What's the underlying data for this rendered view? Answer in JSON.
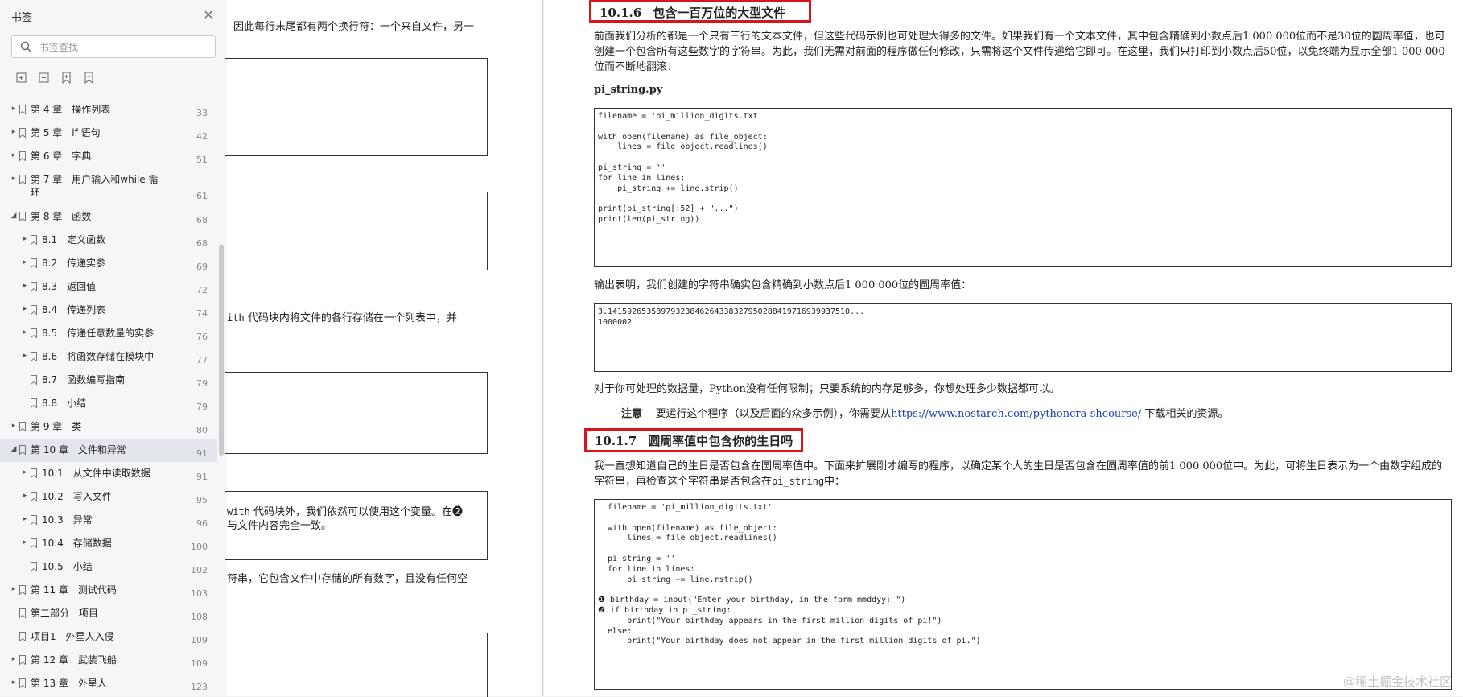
{
  "sidebar": {
    "title": "书签",
    "search_placeholder": "书签查找",
    "bookmarks": [
      {
        "label": "第 4 章　操作列表",
        "page": "33",
        "level": 0,
        "arrow": "right"
      },
      {
        "label": "第 5 章　if 语句",
        "page": "42",
        "level": 0,
        "arrow": "right"
      },
      {
        "label": "第 6 章　字典",
        "page": "51",
        "level": 0,
        "arrow": "right"
      },
      {
        "label": "第 7 章　用户输入和while 循",
        "label2": "环",
        "page": "61",
        "level": 0,
        "arrow": "right"
      },
      {
        "label": "第 8 章　函数",
        "page": "68",
        "level": 0,
        "arrow": "down"
      },
      {
        "label": "8.1　定义函数",
        "page": "68",
        "level": 1,
        "arrow": "right"
      },
      {
        "label": "8.2　传递实参",
        "page": "69",
        "level": 1,
        "arrow": "right"
      },
      {
        "label": "8.3　返回值",
        "page": "72",
        "level": 1,
        "arrow": "right"
      },
      {
        "label": "8.4　传递列表",
        "page": "74",
        "level": 1,
        "arrow": "right"
      },
      {
        "label": "8.5　传递任意数量的实参",
        "page": "76",
        "level": 1,
        "arrow": "right"
      },
      {
        "label": "8.6　将函数存储在模块中",
        "page": "77",
        "level": 1,
        "arrow": "right"
      },
      {
        "label": "8.7　函数编写指南",
        "page": "79",
        "level": 1,
        "arrow": "none"
      },
      {
        "label": "8.8　小结",
        "page": "79",
        "level": 1,
        "arrow": "none"
      },
      {
        "label": "第 9 章　类",
        "page": "80",
        "level": 0,
        "arrow": "right"
      },
      {
        "label": "第 10 章　文件和异常",
        "page": "91",
        "level": 0,
        "arrow": "down",
        "selected": true
      },
      {
        "label": "10.1　从文件中读取数据",
        "page": "91",
        "level": 1,
        "arrow": "right"
      },
      {
        "label": "10.2　写入文件",
        "page": "95",
        "level": 1,
        "arrow": "right"
      },
      {
        "label": "10.3　异常",
        "page": "96",
        "level": 1,
        "arrow": "right"
      },
      {
        "label": "10.4　存储数据",
        "page": "100",
        "level": 1,
        "arrow": "right"
      },
      {
        "label": "10.5　小结",
        "page": "102",
        "level": 1,
        "arrow": "none"
      },
      {
        "label": "第 11 章　测试代码",
        "page": "103",
        "level": 0,
        "arrow": "right"
      },
      {
        "label": "第二部分　项目",
        "page": "108",
        "level": 0,
        "arrow": "none"
      },
      {
        "label": "项目1　外星人入侵",
        "page": "109",
        "level": 0,
        "arrow": "none"
      },
      {
        "label": "第 12 章　武装飞船",
        "page": "109",
        "level": 0,
        "arrow": "right"
      },
      {
        "label": "第 13 章　外星人",
        "page": "123",
        "level": 0,
        "arrow": "right"
      }
    ]
  },
  "left_page": {
    "line1": "因此每行末尾都有两个换行符：一个来自文件，另一",
    "line2_code": "ith",
    "line2_text": " 代码块内将文件的各行存储在一个列表中，并",
    "line3_code": "with",
    "line3_text": " 代码块外，我们依然可以使用这个变量。在",
    "line3_marker": "❷",
    "line4": "与文件内容完全一致。",
    "line5": "符串，它包含文件中存储的所有数字，且没有任何空"
  },
  "right_page": {
    "h1_num": "10.1.6",
    "h1_title": "包含一百万位的大型文件",
    "p1": "前面我们分析的都是一个只有三行的文本文件，但这些代码示例也可处理大得多的文件。如果我们有一个文本文件，其中包含精确到小数点后1 000 000位而不是30位的圆周率值，也可创建一个包含所有这些数字的字符串。为此，我们无需对前面的程序做任何修改，只需将这个文件传递给它即可。在这里，我们只打印到小数点后50位，以免终端为显示全部1 000 000位而不断地翻滚：",
    "filename_label": "pi_string.py",
    "code1": "filename = 'pi_million_digits.txt'\n\nwith open(filename) as file_object:\n    lines = file_object.readlines()\n\npi_string = ''\nfor line in lines:\n    pi_string += line.strip()\n\nprint(pi_string[:52] + \"...\")\nprint(len(pi_string))",
    "p2": "输出表明，我们创建的字符串确实包含精确到小数点后1 000 000位的圆周率值：",
    "code2": "3.14159265358979323846264338327950288419716939937510...\n1000002",
    "p3": "对于你可处理的数据量，Python没有任何限制；只要系统的内存足够多，你想处理多少数据都可以。",
    "note_label": "注意",
    "note_text": "要运行这个程序（以及后面的众多示例），你需要从",
    "note_link": "https://www.nostarch.com/pythoncra-shcourse/",
    "note_text2": " 下载相关的资源。",
    "h2_num": "10.1.7",
    "h2_title": "圆周率值中包含你的生日吗",
    "p4a": "我一直想知道自己的生日是否包含在圆周率值中。下面来扩展刚才编写的程序，以确定某个人的生日是否包含在圆周率值的前1 000 000位中。为此，可将生日表示为一个由数字组成的字符串，再检查这个字符串是否包含在",
    "p4_code": "pi_string",
    "p4b": "中：",
    "code3": "  filename = 'pi_million_digits.txt'\n\n  with open(filename) as file_object:\n      lines = file_object.readlines()\n\n  pi_string = ''\n  for line in lines:\n      pi_string += line.rstrip()\n\n❶ birthday = input(\"Enter your birthday, in the form mmddyy: \")\n❷ if birthday in pi_string:\n      print(\"Your birthday appears in the first million digits of pi!\")\n  else:\n      print(\"Your birthday does not appear in the first million digits of pi.\")"
  },
  "watermark": "@稀土掘金技术社区"
}
